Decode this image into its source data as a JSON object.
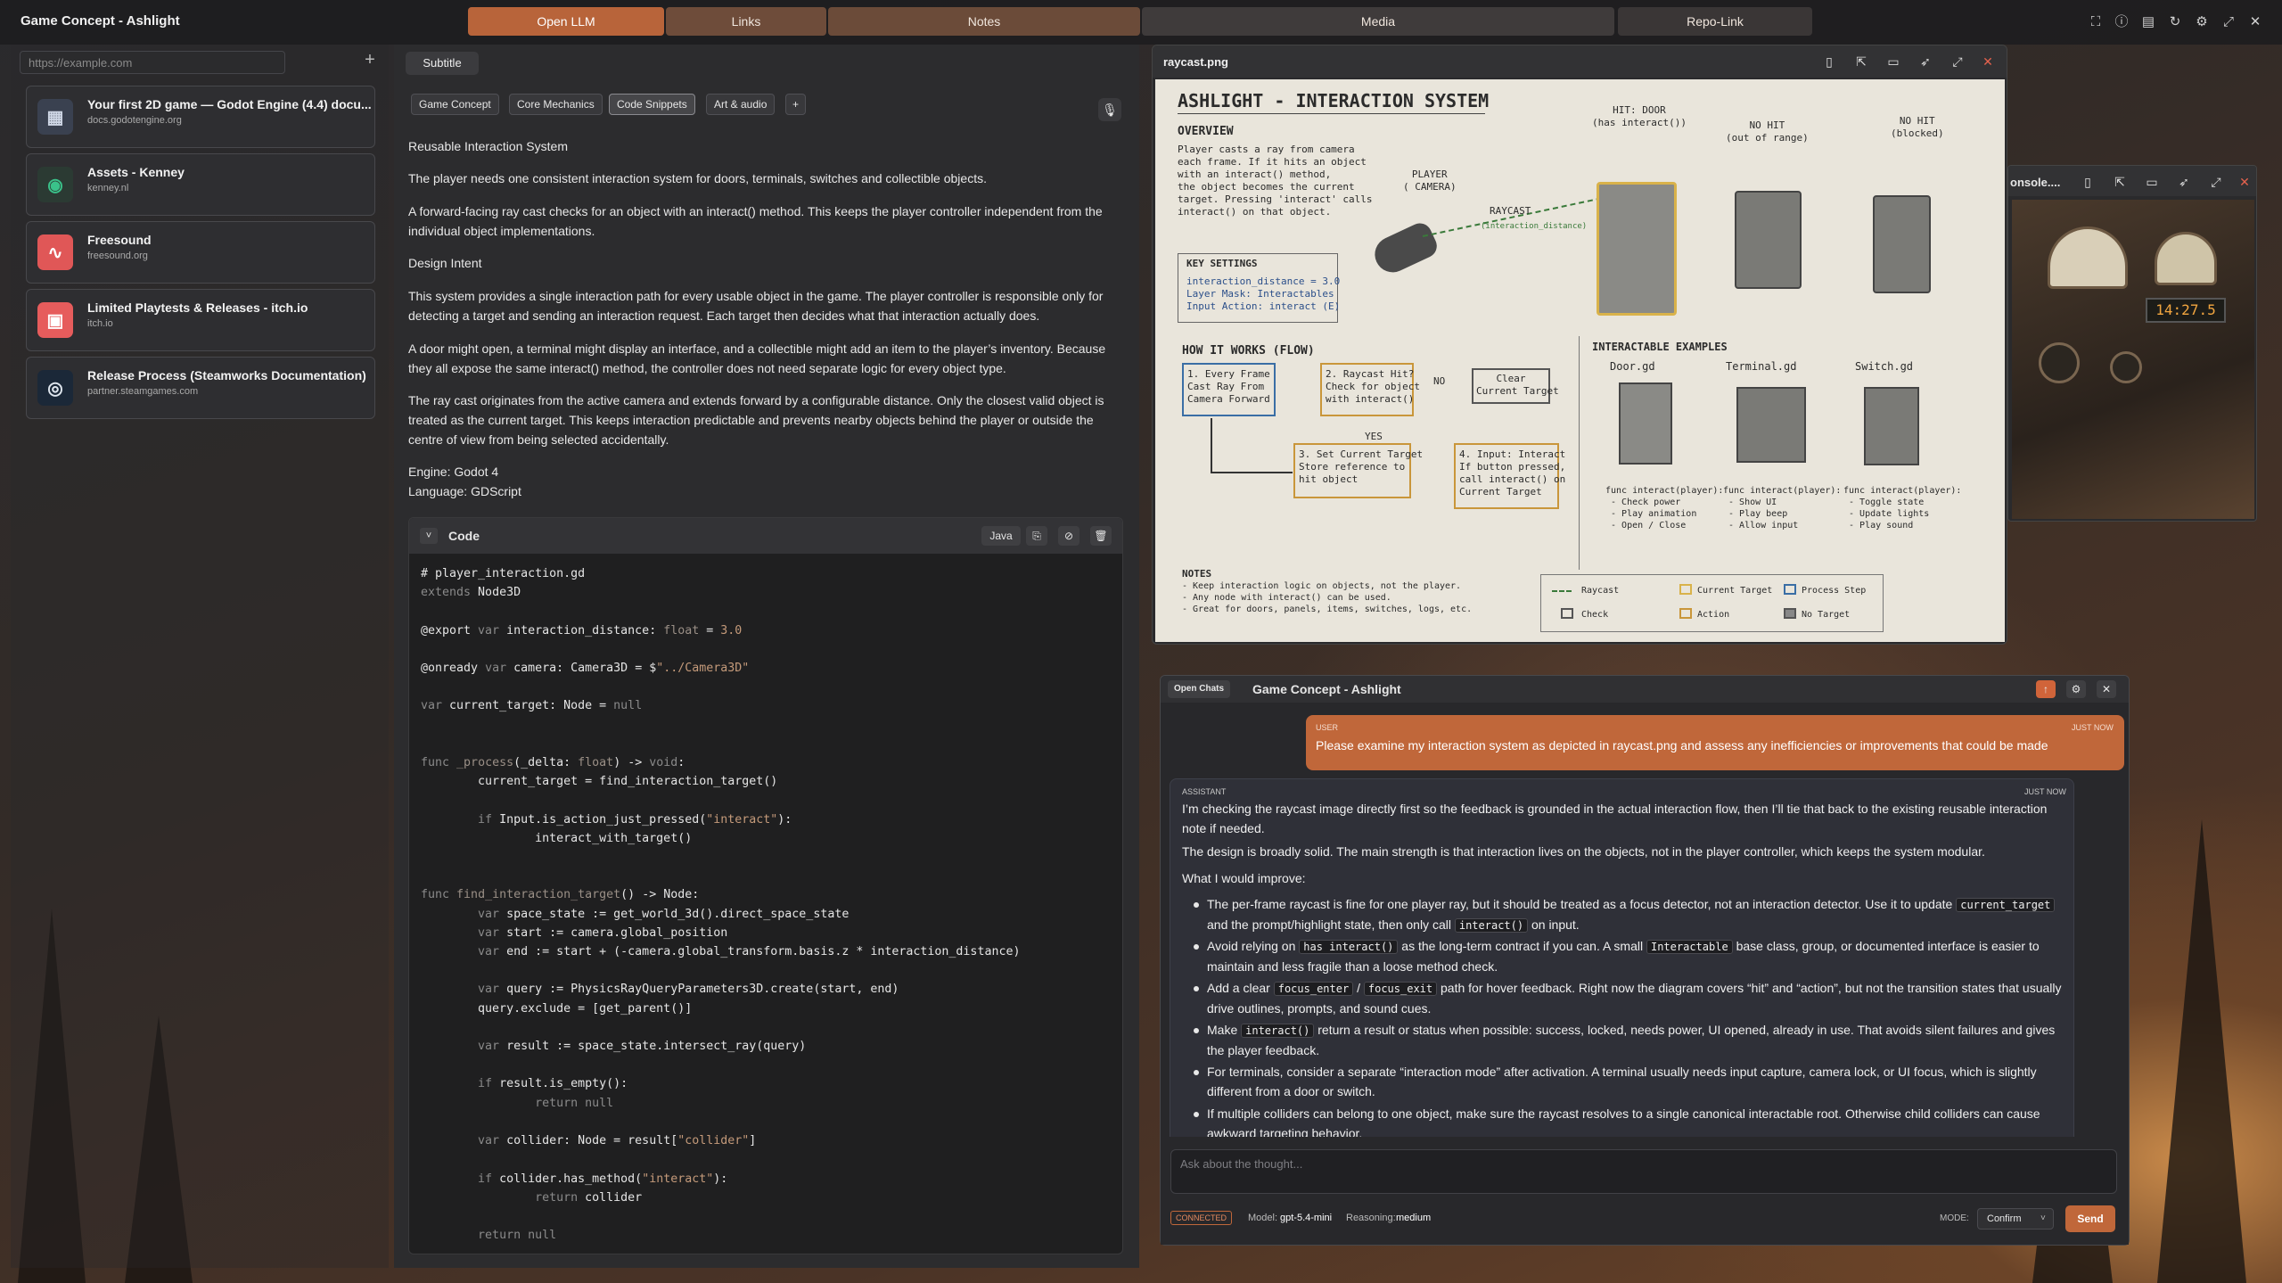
{
  "app": {
    "title": "Game Concept - Ashlight"
  },
  "tabs": [
    {
      "label": "Open LLM"
    },
    {
      "label": "Links"
    },
    {
      "label": "Notes"
    },
    {
      "label": "Media"
    },
    {
      "label": "Repo-Link"
    }
  ],
  "url_bar": {
    "placeholder": "https://example.com"
  },
  "bookmarks": [
    {
      "title": "Your first 2D game — Godot Engine (4.4) docu...",
      "domain": "docs.godotengine.org",
      "icon": "godot-icon"
    },
    {
      "title": "Assets - Kenney",
      "domain": "kenney.nl",
      "icon": "kenney-icon"
    },
    {
      "title": "Freesound",
      "domain": "freesound.org",
      "icon": "freesound-icon"
    },
    {
      "title": "Limited Playtests & Releases - itch.io",
      "domain": "itch.io",
      "icon": "itchio-icon"
    },
    {
      "title": "Release Process (Steamworks Documentation)",
      "domain": "partner.steamgames.com",
      "icon": "steam-icon"
    }
  ],
  "notes": {
    "subtitle_label": "Subtitle",
    "chips": [
      "Game Concept",
      "Core Mechanics",
      "Code Snippets",
      "Art & audio",
      "+"
    ],
    "paragraphs": [
      "Reusable Interaction System",
      "The player needs one consistent interaction system for doors, terminals, switches and collectible objects.",
      "A forward-facing ray cast checks for an object with an interact() method. This keeps the player controller independent from the individual object implementations.",
      "Design Intent",
      "This system provides a single interaction path for every usable object in the game. The player controller is responsible only for detecting a target and sending an interaction request. Each target then decides what that interaction actually does.",
      "A door might open, a terminal might display an interface, and a collectible might add an item to the player’s inventory. Because they all expose the same interact() method, the controller does not need separate logic for every object type.",
      "The ray cast originates from the active camera and extends forward by a configurable distance. Only the closest valid object is treated as the current target. This keeps interaction predictable and prevents nearby objects behind the player or outside the centre of view from being selected accidentally.",
      "Engine: Godot 4",
      "Language: GDScript"
    ],
    "code": {
      "title": "Code",
      "language": "Java"
    }
  },
  "image_window": {
    "title": "raycast.png",
    "sketch": {
      "title": "ASHLIGHT - INTERACTION SYSTEM",
      "overview_heading": "OVERVIEW",
      "overview_text": "Player casts a ray from camera\neach frame. If it hits an object\nwith an interact() method,\nthe object becomes the current\ntarget. Pressing 'interact' calls\ninteract() on that object.",
      "player_label": "PLAYER\n( CAMERA)",
      "raycast_label": "RAYCAST",
      "raycast_sub": "(interaction_distance)",
      "hit_door": "HIT: DOOR\n(has interact())",
      "no_hit_range": "NO HIT\n(out of range)",
      "no_hit_blocked": "NO HIT\n(blocked)",
      "key_settings_heading": "KEY SETTINGS",
      "key_settings": "interaction_distance = 3.0\nLayer Mask: Interactables\nInput Action: interact (E)",
      "flow_heading": "HOW IT WORKS (FLOW)",
      "flow_1": "1. Every Frame\nCast Ray From\nCamera Forward",
      "flow_2": "2. Raycast Hit?\nCheck for object\nwith interact()",
      "flow_no": "NO",
      "flow_clear": "Clear\nCurrent Target",
      "flow_yes": "YES",
      "flow_3": "3. Set Current Target\nStore reference to\nhit object",
      "flow_4": "4. Input: Interact\nIf button pressed,\ncall interact() on\nCurrent Target",
      "examples_heading": "INTERACTABLE EXAMPLES",
      "examples": [
        {
          "name": "Door.gd",
          "func": "func interact(player):\n - Check power\n - Play animation\n - Open / Close"
        },
        {
          "name": "Terminal.gd",
          "func": "func interact(player):\n - Show UI\n - Play beep\n - Allow input"
        },
        {
          "name": "Switch.gd",
          "func": "func interact(player):\n - Toggle state\n - Update lights\n - Play sound"
        }
      ],
      "notes_heading": "NOTES",
      "notes": "- Keep interaction logic on objects, not the player.\n- Any node with interact() can be used.\n- Great for doors, panels, items, switches, logs, etc.",
      "legend": [
        "Raycast",
        "Current Target",
        "Process Step",
        "Check",
        "Action",
        "No Target"
      ]
    }
  },
  "console_window": {
    "title": "onsole....",
    "display": "14:27.5"
  },
  "chat": {
    "open_chats_label": "Open Chats",
    "title": "Game Concept - Ashlight",
    "user": {
      "role": "USER",
      "time": "JUST NOW",
      "text": "Please examine my interaction system as depicted in raycast.png and assess any inefficiencies or improvements that could be made"
    },
    "assistant": {
      "role": "ASSISTANT",
      "time": "JUST NOW",
      "intro": "I’m checking the raycast image directly first so the feedback is grounded in the actual interaction flow, then I’ll tie that back to the existing reusable interaction note if needed.",
      "summary": "The design is broadly solid. The main strength is that interaction lives on the objects, not in the player controller, which keeps the system modular.",
      "improve_heading": "What I would improve:"
    },
    "input_placeholder": "Ask about the thought...",
    "status": "CONNECTED",
    "model_label": "Model:",
    "model": "gpt-5.4-mini",
    "reasoning_label": "Reasoning:",
    "reasoning": "medium",
    "mode_label": "MODE:",
    "mode": "Confirm",
    "send_label": "Send"
  },
  "colors": {
    "accent": "#c0673a",
    "tab_active": "#b8643a"
  }
}
